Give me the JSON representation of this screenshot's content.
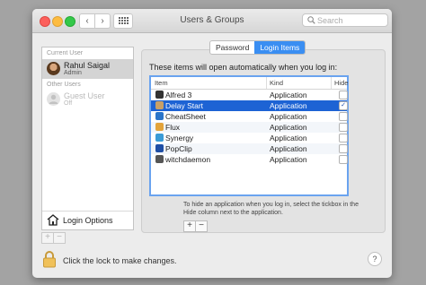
{
  "window": {
    "title": "Users & Groups"
  },
  "search": {
    "placeholder": "Search"
  },
  "sidebar": {
    "current_user_label": "Current User",
    "other_users_label": "Other Users",
    "users": [
      {
        "name": "Rahul Saigal",
        "sub": "Admin"
      },
      {
        "name": "Guest User",
        "sub": "Off"
      }
    ],
    "login_options": "Login Options",
    "add": "+",
    "remove": "−"
  },
  "tabs": [
    "Password",
    "Login Items"
  ],
  "login_items": {
    "intro": "These items will open automatically when you log in:",
    "columns": {
      "item": "Item",
      "kind": "Kind",
      "hide": "Hide"
    },
    "rows": [
      {
        "name": "Alfred 3",
        "kind": "Application",
        "hide": false,
        "icon": "alfred-icon",
        "color": "#333333"
      },
      {
        "name": "Delay Start",
        "kind": "Application",
        "hide": true,
        "icon": "delay-start-icon",
        "color": "#c8a067"
      },
      {
        "name": "CheatSheet",
        "kind": "Application",
        "hide": false,
        "icon": "cheatsheet-icon",
        "color": "#2a74c9"
      },
      {
        "name": "Flux",
        "kind": "Application",
        "hide": false,
        "icon": "flux-icon",
        "color": "#e3a33a"
      },
      {
        "name": "Synergy",
        "kind": "Application",
        "hide": false,
        "icon": "synergy-icon",
        "color": "#3a9bd6"
      },
      {
        "name": "PopClip",
        "kind": "Application",
        "hide": false,
        "icon": "popclip-icon",
        "color": "#1f4fa6"
      },
      {
        "name": "witchdaemon",
        "kind": "Application",
        "hide": false,
        "icon": "witch-icon",
        "color": "#555555"
      }
    ],
    "note": "To hide an application when you log in, select the tickbox in the Hide column next to the application.",
    "add": "+",
    "remove": "−"
  },
  "footer": {
    "lock_text": "Click the lock to make changes.",
    "help": "?"
  },
  "colors": {
    "accent": "#3a8ef2",
    "selection": "#1d63d4"
  }
}
